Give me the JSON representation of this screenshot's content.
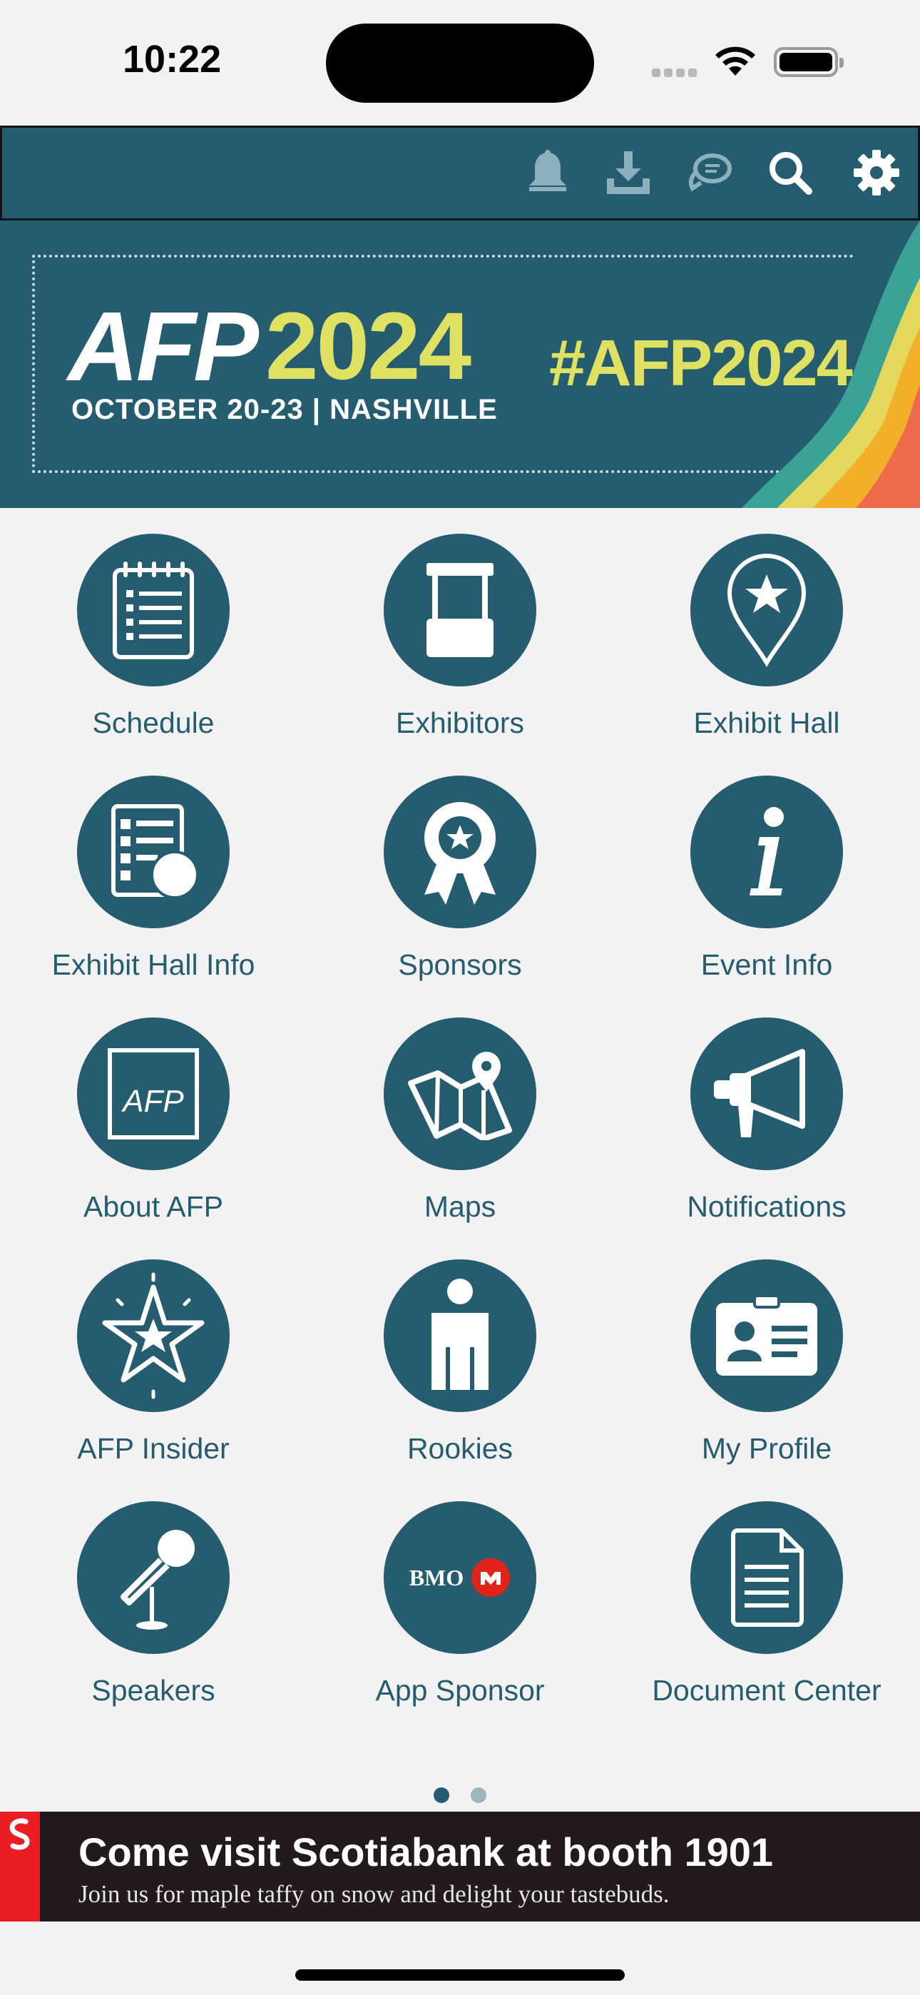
{
  "status_bar": {
    "time": "10:22"
  },
  "toolbar": {
    "icons": [
      "bell-icon",
      "download-icon",
      "chat-icon",
      "search-icon",
      "gear-icon"
    ]
  },
  "banner": {
    "logo_text": "AFP",
    "year": "2024",
    "dates": "OCTOBER 20-23 | NASHVILLE",
    "hashtag": "#AFP2024",
    "accent_color": "#dfe163"
  },
  "grid": {
    "items": [
      {
        "label": "Schedule",
        "icon": "checklist-icon"
      },
      {
        "label": "Exhibitors",
        "icon": "booth-icon"
      },
      {
        "label": "Exhibit Hall",
        "icon": "map-pin-star-icon"
      },
      {
        "label": "Exhibit Hall Info",
        "icon": "list-info-icon"
      },
      {
        "label": "Sponsors",
        "icon": "award-ribbon-icon"
      },
      {
        "label": "Event Info",
        "icon": "info-icon"
      },
      {
        "label": "About AFP",
        "icon": "afp-logo-icon"
      },
      {
        "label": "Maps",
        "icon": "folded-map-icon"
      },
      {
        "label": "Notifications",
        "icon": "megaphone-icon"
      },
      {
        "label": "AFP Insider",
        "icon": "star-outline-icon"
      },
      {
        "label": "Rookies",
        "icon": "person-icon"
      },
      {
        "label": "My Profile",
        "icon": "id-card-icon"
      },
      {
        "label": "Speakers",
        "icon": "microphone-icon"
      },
      {
        "label": "App Sponsor",
        "icon": "bmo-logo-icon",
        "logo_text": "BMO"
      },
      {
        "label": "Document Center",
        "icon": "document-icon"
      }
    ]
  },
  "pager": {
    "pages": 2,
    "current": 1
  },
  "ad": {
    "headline": "Come visit Scotiabank at booth 1901",
    "subline": "Join us for maple taffy on snow and delight your tastebuds.",
    "brand_color": "#ec1c24"
  },
  "colors": {
    "primary": "#265c70",
    "background": "#f2f2f3"
  }
}
